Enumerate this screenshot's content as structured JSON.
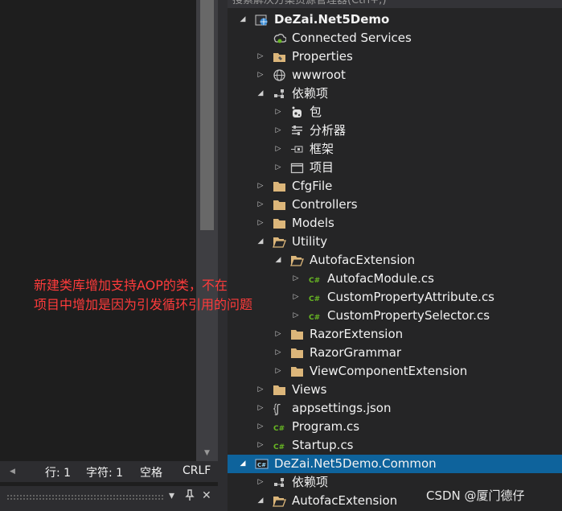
{
  "solution_explorer": {
    "search_placeholder": "搜索解决方案资源管理器(Ctrl+;)",
    "items": [
      {
        "label": "DeZai.Net5Demo",
        "expander": "open",
        "icon": "web-project-icon",
        "name": "project-dezai-net5demo",
        "bold": true
      },
      {
        "label": "Connected Services",
        "expander": "none",
        "icon": "connected-services-icon",
        "name": "node-connected-services"
      },
      {
        "label": "Properties",
        "expander": "closed",
        "icon": "properties-folder-icon",
        "name": "node-properties"
      },
      {
        "label": "wwwroot",
        "expander": "closed",
        "icon": "globe-icon",
        "name": "node-wwwroot"
      },
      {
        "label": "依赖项",
        "expander": "open",
        "icon": "dependencies-icon",
        "name": "node-dependencies"
      },
      {
        "label": "包",
        "expander": "closed",
        "icon": "package-icon",
        "name": "node-packages"
      },
      {
        "label": "分析器",
        "expander": "closed",
        "icon": "analyzer-icon",
        "name": "node-analyzers"
      },
      {
        "label": "框架",
        "expander": "closed",
        "icon": "framework-icon",
        "name": "node-frameworks"
      },
      {
        "label": "项目",
        "expander": "closed",
        "icon": "project-ref-icon",
        "name": "node-project-refs"
      },
      {
        "label": "CfgFile",
        "expander": "closed",
        "icon": "folder-icon",
        "name": "folder-cfgfile"
      },
      {
        "label": "Controllers",
        "expander": "closed",
        "icon": "folder-icon",
        "name": "folder-controllers"
      },
      {
        "label": "Models",
        "expander": "closed",
        "icon": "folder-icon",
        "name": "folder-models"
      },
      {
        "label": "Utility",
        "expander": "open",
        "icon": "folder-open-icon",
        "name": "folder-utility"
      },
      {
        "label": "AutofacExtension",
        "expander": "open",
        "icon": "folder-open-icon",
        "name": "folder-autofacextension"
      },
      {
        "label": "AutofacModule.cs",
        "expander": "closed",
        "icon": "csharp-file-icon",
        "name": "file-autofacmodule"
      },
      {
        "label": "CustomPropertyAttribute.cs",
        "expander": "closed",
        "icon": "csharp-file-icon",
        "name": "file-custompropertyattribute"
      },
      {
        "label": "CustomPropertySelector.cs",
        "expander": "closed",
        "icon": "csharp-file-icon",
        "name": "file-custompropertyselector"
      },
      {
        "label": "RazorExtension",
        "expander": "closed",
        "icon": "folder-icon",
        "name": "folder-razorextension"
      },
      {
        "label": "RazorGrammar",
        "expander": "closed",
        "icon": "folder-icon",
        "name": "folder-razorgrammar"
      },
      {
        "label": "ViewComponentExtension",
        "expander": "closed",
        "icon": "folder-icon",
        "name": "folder-viewcomponentextension"
      },
      {
        "label": "Views",
        "expander": "closed",
        "icon": "folder-icon",
        "name": "folder-views"
      },
      {
        "label": "appsettings.json",
        "expander": "closed",
        "icon": "json-file-icon",
        "name": "file-appsettings"
      },
      {
        "label": "Program.cs",
        "expander": "closed",
        "icon": "csharp-file-icon",
        "name": "file-program"
      },
      {
        "label": "Startup.cs",
        "expander": "closed",
        "icon": "csharp-file-icon",
        "name": "file-startup"
      },
      {
        "label": "DeZai.Net5Demo.Common",
        "expander": "open",
        "icon": "csharp-project-icon",
        "name": "project-dezai-net5demo-common",
        "selected": true
      },
      {
        "label": "依赖项",
        "expander": "closed",
        "icon": "dependencies-icon",
        "name": "node-common-dependencies"
      },
      {
        "label": "AutofacExtension",
        "expander": "open",
        "icon": "folder-open-icon",
        "name": "folder-common-autofacextension"
      }
    ]
  },
  "status_bar": {
    "line": "行: 1",
    "char": "字符: 1",
    "spaces": "空格",
    "line_ending": "CRLF"
  },
  "annotation": {
    "line1": "新建类库增加支持AOP的类，不在",
    "line2": "项目中增加是因为引发循环引用的问题"
  },
  "watermark": "CSDN @厦门德仔",
  "colors": {
    "selection": "#0e639c",
    "annotation_text": "#ff3b3b",
    "folder": "#dcb67a",
    "csharp": "#68b723"
  }
}
